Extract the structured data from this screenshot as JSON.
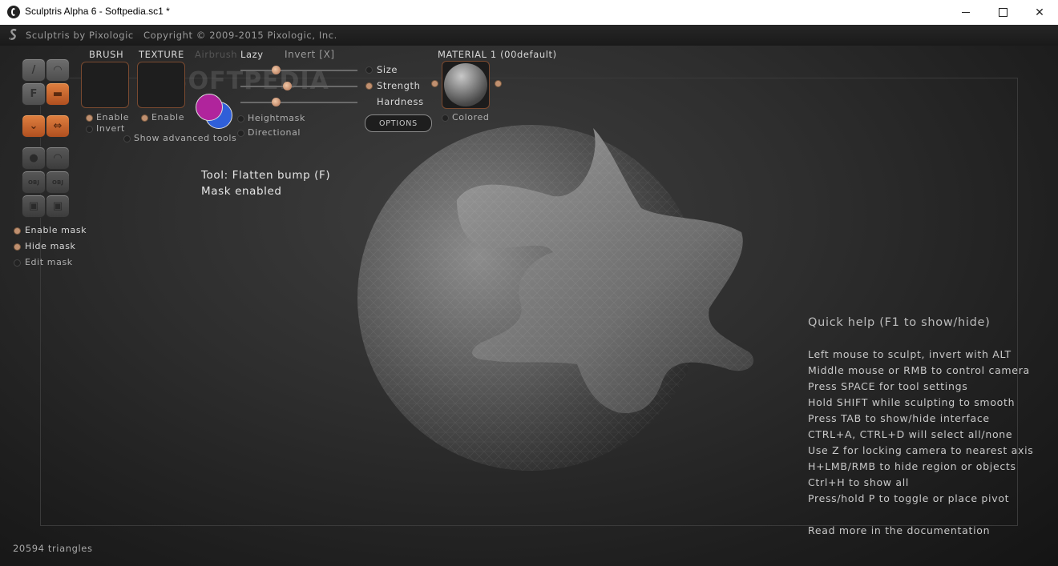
{
  "window": {
    "title": "Sculptris Alpha 6 - Softpedia.sc1 *",
    "minimize_glyph": "—",
    "maximize_glyph": "☐",
    "close_glyph": "✕"
  },
  "header": {
    "app_name": "Sculptris by Pixologic",
    "copyright": "Copyright © 2009-2015 Pixologic, Inc."
  },
  "watermark": "SOFTPEDIA",
  "toolbar": {
    "tools": [
      {
        "name": "draw-tool-icon",
        "glyph": "/",
        "active": false
      },
      {
        "name": "crease-tool-icon",
        "glyph": "◠",
        "active": false
      },
      {
        "name": "flatten-tool-icon",
        "glyph": "F",
        "active": false
      },
      {
        "name": "pinch-tool-icon",
        "glyph": "▬",
        "active": true
      },
      {
        "name": "inflate-tool-icon",
        "glyph": "⌄",
        "active": true
      },
      {
        "name": "grab-tool-icon",
        "glyph": "⇔",
        "active": true
      },
      {
        "name": "smooth-tool-icon",
        "glyph": "●",
        "active": false
      },
      {
        "name": "scale-tool-icon",
        "glyph": "◠",
        "active": false
      },
      {
        "name": "import-obj-icon",
        "glyph": "OBJ",
        "active": false
      },
      {
        "name": "export-obj-icon",
        "glyph": "OBJ",
        "active": false
      },
      {
        "name": "open-file-icon",
        "glyph": "▣",
        "active": false
      },
      {
        "name": "save-file-icon",
        "glyph": "▣",
        "active": false
      }
    ],
    "mask_options": [
      {
        "label": "Enable mask",
        "on": true
      },
      {
        "label": "Hide mask",
        "on": true
      },
      {
        "label": "Edit mask",
        "on": false
      }
    ]
  },
  "brush_panel": {
    "brush_label": "BRUSH",
    "texture_label": "TEXTURE",
    "brush_enable": "Enable",
    "brush_invert": "Invert",
    "texture_enable": "Enable",
    "show_advanced": "Show advanced tools",
    "airbrush": "Airbrush",
    "lazy": "Lazy",
    "invert_key": "Invert [X]",
    "size": "Size",
    "strength": "Strength",
    "hardness": "Hardness",
    "heightmask": "Heightmask",
    "directional": "Directional",
    "options": "OPTIONS",
    "color_front": "#b0249c",
    "color_back": "#2f5fd8"
  },
  "material": {
    "label": "MATERIAL 1 (00default)",
    "colored": "Colored"
  },
  "status": {
    "tool": "Tool: Flatten bump (F)",
    "mask": "Mask enabled",
    "triangles": "20594 triangles"
  },
  "quick_help": {
    "title": "Quick help (F1 to show/hide)",
    "lines": [
      "Left mouse to sculpt, invert with ALT",
      "Middle mouse or RMB to control camera",
      "Press SPACE for tool settings",
      "Hold SHIFT while sculpting to smooth",
      "Press TAB to show/hide interface",
      "CTRL+A, CTRL+D will select all/none",
      "Use Z for locking camera to nearest axis",
      "H+LMB/RMB to hide region or objects",
      "Ctrl+H to show all",
      "Press/hold P to toggle or place pivot"
    ],
    "doc_link": "Read more in the documentation"
  }
}
